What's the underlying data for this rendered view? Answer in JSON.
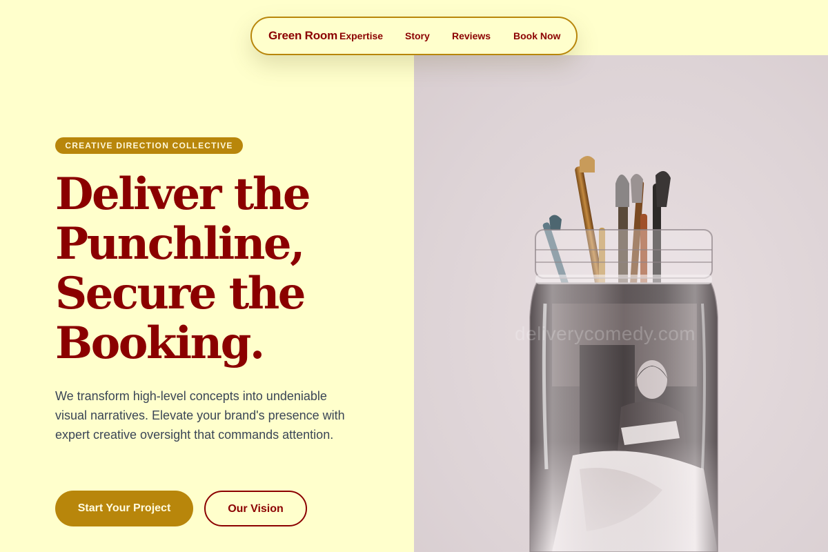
{
  "nav": {
    "brand": "Green Room",
    "links": [
      {
        "label": "Expertise"
      },
      {
        "label": "Story"
      },
      {
        "label": "Reviews"
      },
      {
        "label": "Book Now"
      }
    ]
  },
  "hero": {
    "badge": "CREATIVE DIRECTION COLLECTIVE",
    "headline_lines": [
      "Deliver the",
      "Punchline,",
      "Secure the",
      "Booking."
    ],
    "description": "We transform high-level concepts into undeniable visual narratives. Elevate your brand's presence with expert creative oversight that commands attention.",
    "primary_cta": "Start Your Project",
    "secondary_cta": "Our Vision"
  },
  "image": {
    "subject": "glass jar with paint brushes and vintage photo",
    "watermark": "deliverycomedy.com"
  },
  "colors": {
    "background": "#ffffcc",
    "accent_gold": "#b8860b",
    "dark_red": "#8b0000",
    "body_text": "#3a4556"
  }
}
